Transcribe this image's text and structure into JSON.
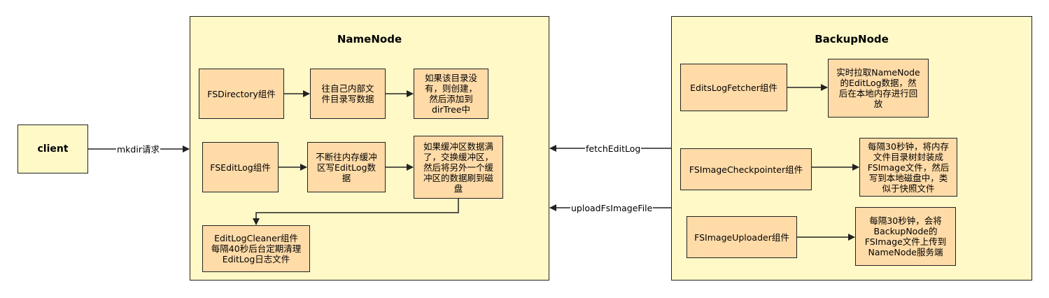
{
  "containers": {
    "namenode": {
      "title": "NameNode"
    },
    "backupnode": {
      "title": "BackupNode"
    }
  },
  "client": {
    "label": "client"
  },
  "namenode": {
    "fsdirectory": "FSDirectory组件",
    "fsdirectory_write": "往自己内部文\n件目录写数据",
    "fsdirectory_create": "如果该目录没\n有，则创建，\n然后添加到\ndirTree中",
    "fseditlog": "FSEditLog组件",
    "fseditlog_write": "不断往内存缓冲\n区写EditLog数\n据",
    "fseditlog_flush": "如果缓冲区数据满\n了，交换缓冲区，\n然后将另外一个缓\n冲区的数据刷到磁\n盘",
    "editlogcleaner": "EditLogCleaner组件\n每隔40秒后台定期清理\nEditLog日志文件"
  },
  "backupnode": {
    "editslogfetcher": "EditsLogFetcher组件",
    "editslogfetcher_desc": "实时拉取NameNode\n的EditLog数据，然\n后在本地内存进行回\n放",
    "checkpointer": "FSImageCheckpointer组件",
    "checkpointer_desc": "每隔30秒钟，将内存\n文件目录树封装成\nFSImage文件，然后\n写到本地磁盘中，类\n似于快照文件",
    "uploader": "FSImageUploader组件",
    "uploader_desc": "每隔30秒钟，会将\nBackupNode的\nFSImage文件上传到\nNameNode服务端"
  },
  "edges": {
    "mkdir": "mkdir请求",
    "fetch": "fetchEditLog",
    "upload": "uploadFsImageFile"
  },
  "colors": {
    "container_fill": "#fff9c8",
    "box_fill": "#ffdba8",
    "stroke": "#222222"
  }
}
